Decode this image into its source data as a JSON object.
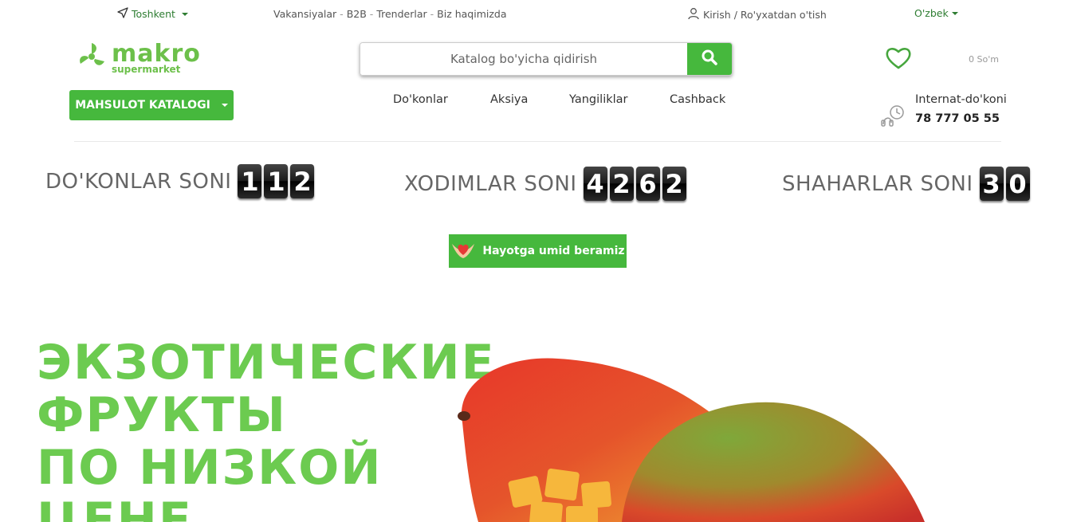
{
  "topbar": {
    "city": "Toshkent",
    "links": [
      "Vakansiyalar",
      "B2B",
      "Trenderlar",
      "Biz haqimizda"
    ],
    "auth": "Kirish / Ro'yxatdan o'tish",
    "language": "O'zbek"
  },
  "header": {
    "logo_word": "makro",
    "logo_sub": "supermarket",
    "search_placeholder": "Katalog bo'yicha qidirish",
    "cart_total": "0 So'm",
    "catalog_button": "MAHSULOT KATALOGI",
    "nav": [
      "Do'konlar",
      "Aksiya",
      "Yangiliklar",
      "Cashback"
    ],
    "shop_label": "Internat-do'koni",
    "shop_phone": "78 777 05 55"
  },
  "stats": [
    {
      "label": "DO'KONLAR SONI",
      "digits": [
        "1",
        "1",
        "2"
      ]
    },
    {
      "label": "XODIMLAR SONI",
      "digits": [
        "4",
        "2",
        "6",
        "2"
      ]
    },
    {
      "label": "SHAHARLAR SONI",
      "digits": [
        "3",
        "0"
      ]
    }
  ],
  "hope_button": "Hayotga umid beramiz",
  "banner": {
    "lines": [
      "ЭКЗОТИЧЕСКИЕ",
      "ФРУКТЫ",
      "ПО НИЗКОЙ",
      "ЦЕНЕ"
    ]
  },
  "colors": {
    "brand_green": "#46b83d",
    "logo_green": "#6cc04a",
    "banner_text": "#6ccb50"
  }
}
